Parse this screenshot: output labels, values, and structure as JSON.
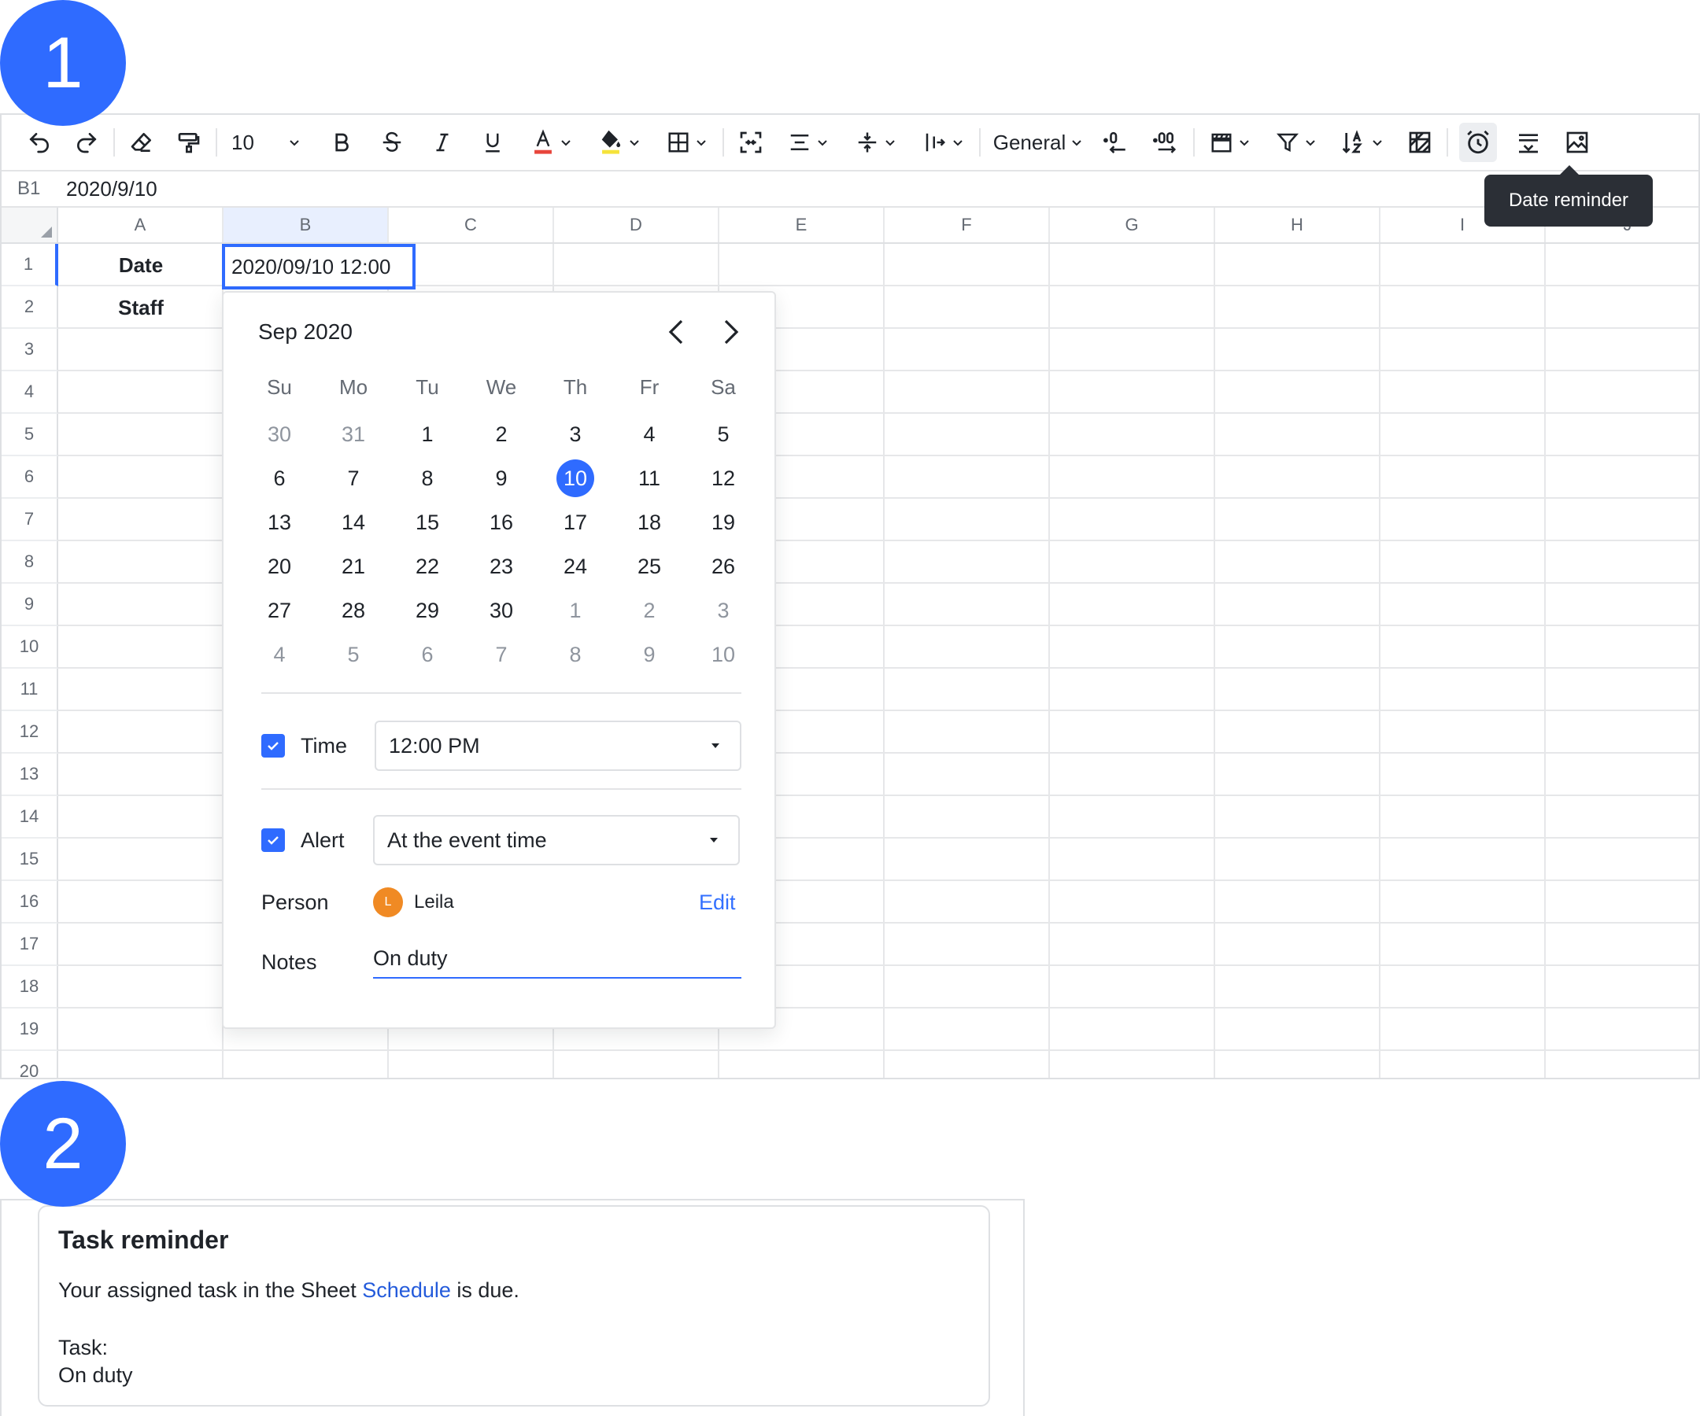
{
  "badges": {
    "step1": "1",
    "step2": "2"
  },
  "toolbar": {
    "font_size": "10",
    "number_format": "General",
    "tooltip": "Date reminder",
    "icons": [
      "undo-icon",
      "redo-icon",
      "eraser-icon",
      "format-painter-icon",
      "bold-icon",
      "strikethrough-icon",
      "italic-icon",
      "underline-icon",
      "font-color-icon",
      "fill-color-icon",
      "borders-icon",
      "merge-cells-icon",
      "horizontal-align-icon",
      "vertical-align-icon",
      "text-wrap-icon",
      "decrease-decimal-icon",
      "increase-decimal-icon",
      "freeze-icon",
      "filter-icon",
      "sort-icon",
      "conditional-format-icon",
      "date-reminder-icon",
      "dropdown-list-icon",
      "insert-image-icon"
    ]
  },
  "formula_bar": {
    "cell_ref": "B1",
    "value": "2020/9/10"
  },
  "grid": {
    "columns": [
      "A",
      "B",
      "C",
      "D",
      "E",
      "F",
      "G",
      "H",
      "I",
      "J"
    ],
    "rows": [
      "1",
      "2",
      "3",
      "4",
      "5",
      "6",
      "7",
      "8",
      "9",
      "10",
      "11",
      "12",
      "13",
      "14",
      "15",
      "16",
      "17",
      "18",
      "19",
      "20"
    ],
    "cells": {
      "A1": "Date",
      "A2": "Staff",
      "B1": "2020/09/10 12:00"
    }
  },
  "calendar": {
    "month_label": "Sep 2020",
    "weekdays": [
      "Su",
      "Mo",
      "Tu",
      "We",
      "Th",
      "Fr",
      "Sa"
    ],
    "days": [
      {
        "d": "30",
        "other": true
      },
      {
        "d": "31",
        "other": true
      },
      {
        "d": "1"
      },
      {
        "d": "2"
      },
      {
        "d": "3"
      },
      {
        "d": "4"
      },
      {
        "d": "5"
      },
      {
        "d": "6"
      },
      {
        "d": "7"
      },
      {
        "d": "8"
      },
      {
        "d": "9"
      },
      {
        "d": "10",
        "selected": true
      },
      {
        "d": "11"
      },
      {
        "d": "12"
      },
      {
        "d": "13"
      },
      {
        "d": "14"
      },
      {
        "d": "15"
      },
      {
        "d": "16"
      },
      {
        "d": "17"
      },
      {
        "d": "18"
      },
      {
        "d": "19"
      },
      {
        "d": "20"
      },
      {
        "d": "21"
      },
      {
        "d": "22"
      },
      {
        "d": "23"
      },
      {
        "d": "24"
      },
      {
        "d": "25"
      },
      {
        "d": "26"
      },
      {
        "d": "27"
      },
      {
        "d": "28"
      },
      {
        "d": "29"
      },
      {
        "d": "30"
      },
      {
        "d": "1",
        "other": true
      },
      {
        "d": "2",
        "other": true
      },
      {
        "d": "3",
        "other": true
      },
      {
        "d": "4",
        "other": true
      },
      {
        "d": "5",
        "other": true
      },
      {
        "d": "6",
        "other": true
      },
      {
        "d": "7",
        "other": true
      },
      {
        "d": "8",
        "other": true
      },
      {
        "d": "9",
        "other": true
      },
      {
        "d": "10",
        "other": true
      }
    ],
    "time_label": "Time",
    "time_value": "12:00 PM",
    "alert_label": "Alert",
    "alert_value": "At the event time",
    "person_label": "Person",
    "person_initial": "L",
    "person_name": "Leila",
    "edit_label": "Edit",
    "notes_label": "Notes",
    "notes_value": "On duty"
  },
  "reminder": {
    "title": "Task reminder",
    "line_prefix": "Your assigned task in the Sheet ",
    "sheet_link": "Schedule",
    "line_suffix": " is due.",
    "task_label": "Task:",
    "task_value": "On duty"
  },
  "colors": {
    "accent": "#2f6bff",
    "link": "#3370ff",
    "avatar": "#f08a24",
    "tooltip_bg": "#2b2f36"
  }
}
